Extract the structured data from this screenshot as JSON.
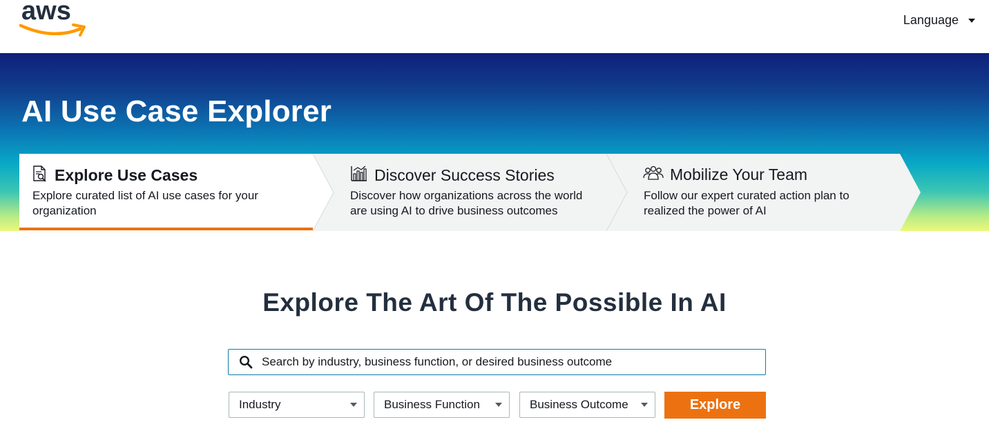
{
  "header": {
    "logo_text": "aws",
    "language_label": "Language"
  },
  "hero": {
    "title": "AI Use Case Explorer"
  },
  "steps": [
    {
      "icon": "document-search-icon",
      "title": "Explore Use Cases",
      "desc_line1": "Explore curated list of AI use cases for your",
      "desc_line2": "organization",
      "active": true
    },
    {
      "icon": "bar-chart-icon",
      "title": "Discover Success Stories",
      "desc_line1": "Discover how organizations across the world",
      "desc_line2": "are using AI to drive business outcomes",
      "active": false
    },
    {
      "icon": "team-icon",
      "title": "Mobilize Your Team",
      "desc_line1": "Follow our expert curated action plan to",
      "desc_line2": "realized the power of AI",
      "active": false
    }
  ],
  "main": {
    "title": "Explore The Art Of The Possible In AI",
    "search_placeholder": "Search by industry, business function, or desired business outcome",
    "filters": {
      "industry": "Industry",
      "business_function": "Business Function",
      "business_outcome": "Business Outcome"
    },
    "explore_label": "Explore"
  },
  "colors": {
    "accent": "#ec7211",
    "search_border": "#0b7ea3",
    "heading": "#232f3e"
  }
}
